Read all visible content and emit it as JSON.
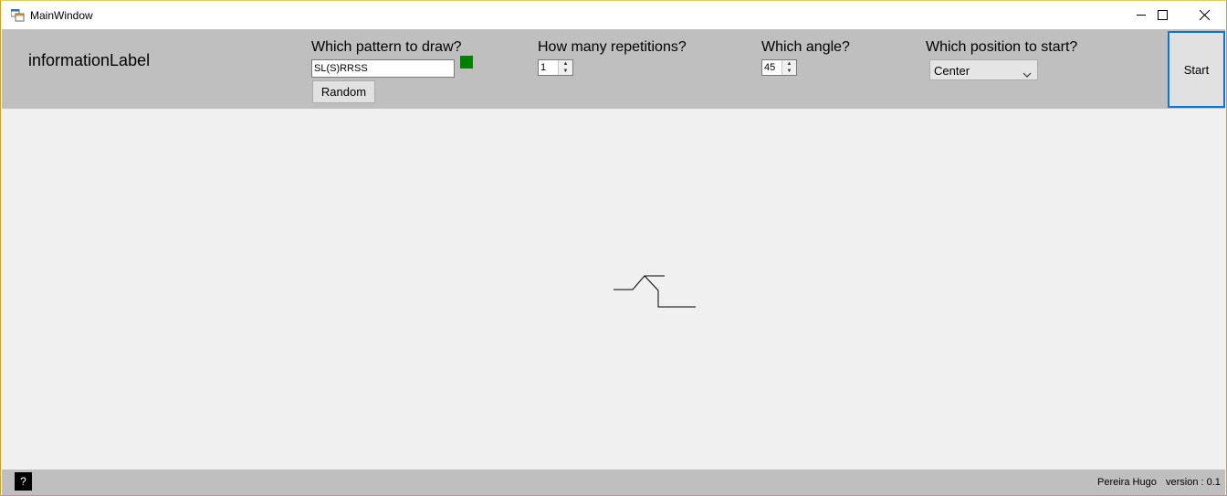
{
  "window": {
    "title": "MainWindow",
    "app_icon": "winforms-app-icon",
    "controls": [
      "minimize-icon",
      "maximize-icon",
      "close-icon"
    ]
  },
  "toolbar": {
    "information_label": "informationLabel",
    "pattern": {
      "label": "Which pattern to draw?",
      "value": "SL(S)RRSS",
      "valid_indicator_color": "#008000",
      "random_label": "Random"
    },
    "repetitions": {
      "label": "How many repetitions?",
      "value": "1"
    },
    "angle": {
      "label": "Which angle?",
      "value": "45"
    },
    "position": {
      "label": "Which position to start?",
      "selected": "Center"
    },
    "start_label": "Start"
  },
  "drawing": {
    "pattern": "SL(S)RRSS",
    "stroke_color": "#000000"
  },
  "status": {
    "help_label": "?",
    "author": "Pereira Hugo",
    "version": "version : 0.1"
  },
  "colors": {
    "toolbar_bg": "#bfbfbf",
    "canvas_bg": "#f0f0f0",
    "focus_border": "#0078d7"
  }
}
